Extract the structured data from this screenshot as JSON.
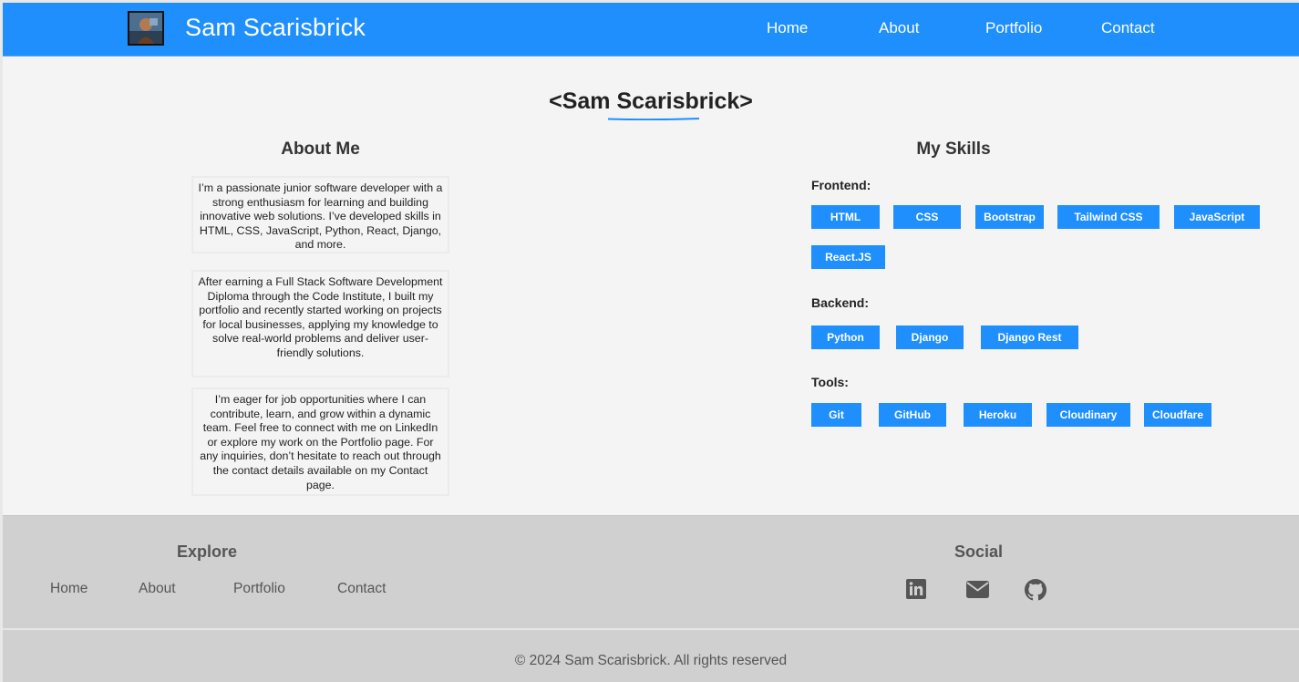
{
  "header": {
    "site_name": "Sam Scarisbrick",
    "nav": [
      "Home",
      "About",
      "Portfolio",
      "Contact"
    ]
  },
  "main": {
    "title": "<Sam Scarisbrick>",
    "about": {
      "heading": "About Me",
      "paragraphs": [
        "I’m a passionate junior software developer with a strong enthusiasm for learning and building innovative web solutions. I’ve developed skills in HTML, CSS, JavaScript, Python, React, Django, and more.",
        "After earning a Full Stack Software Development Diploma through the Code Institute, I built my portfolio and recently started working on projects for local businesses, applying my knowledge to solve real-world problems and deliver user-friendly solutions.",
        "I’m eager for job opportunities where I can contribute, learn, and grow within a dynamic team. Feel free to connect with me on LinkedIn or explore my work on the Portfolio page. For any inquiries, don’t hesitate to reach out through the contact details available on my Contact page."
      ]
    },
    "skills": {
      "heading": "My Skills",
      "frontend_label": "Frontend:",
      "frontend": [
        "HTML",
        "CSS",
        "Bootstrap",
        "Tailwind CSS",
        "JavaScript",
        "React.JS"
      ],
      "backend_label": "Backend:",
      "backend": [
        "Python",
        "Django",
        "Django Rest"
      ],
      "tools_label": "Tools:",
      "tools": [
        "Git",
        "GitHub",
        "Heroku",
        "Cloudinary",
        "Cloudfare"
      ]
    }
  },
  "footer": {
    "explore_heading": "Explore",
    "links": [
      "Home",
      "About",
      "Portfolio",
      "Contact"
    ],
    "social_heading": "Social",
    "social_icons": [
      "linkedin-icon",
      "envelope-icon",
      "github-icon"
    ],
    "copyright": "© 2024 Sam Scarisbrick. All rights reserved"
  },
  "colors": {
    "accent": "#1e8ffd",
    "background": "#f4f4f4",
    "footer": "#d0d0d0"
  }
}
